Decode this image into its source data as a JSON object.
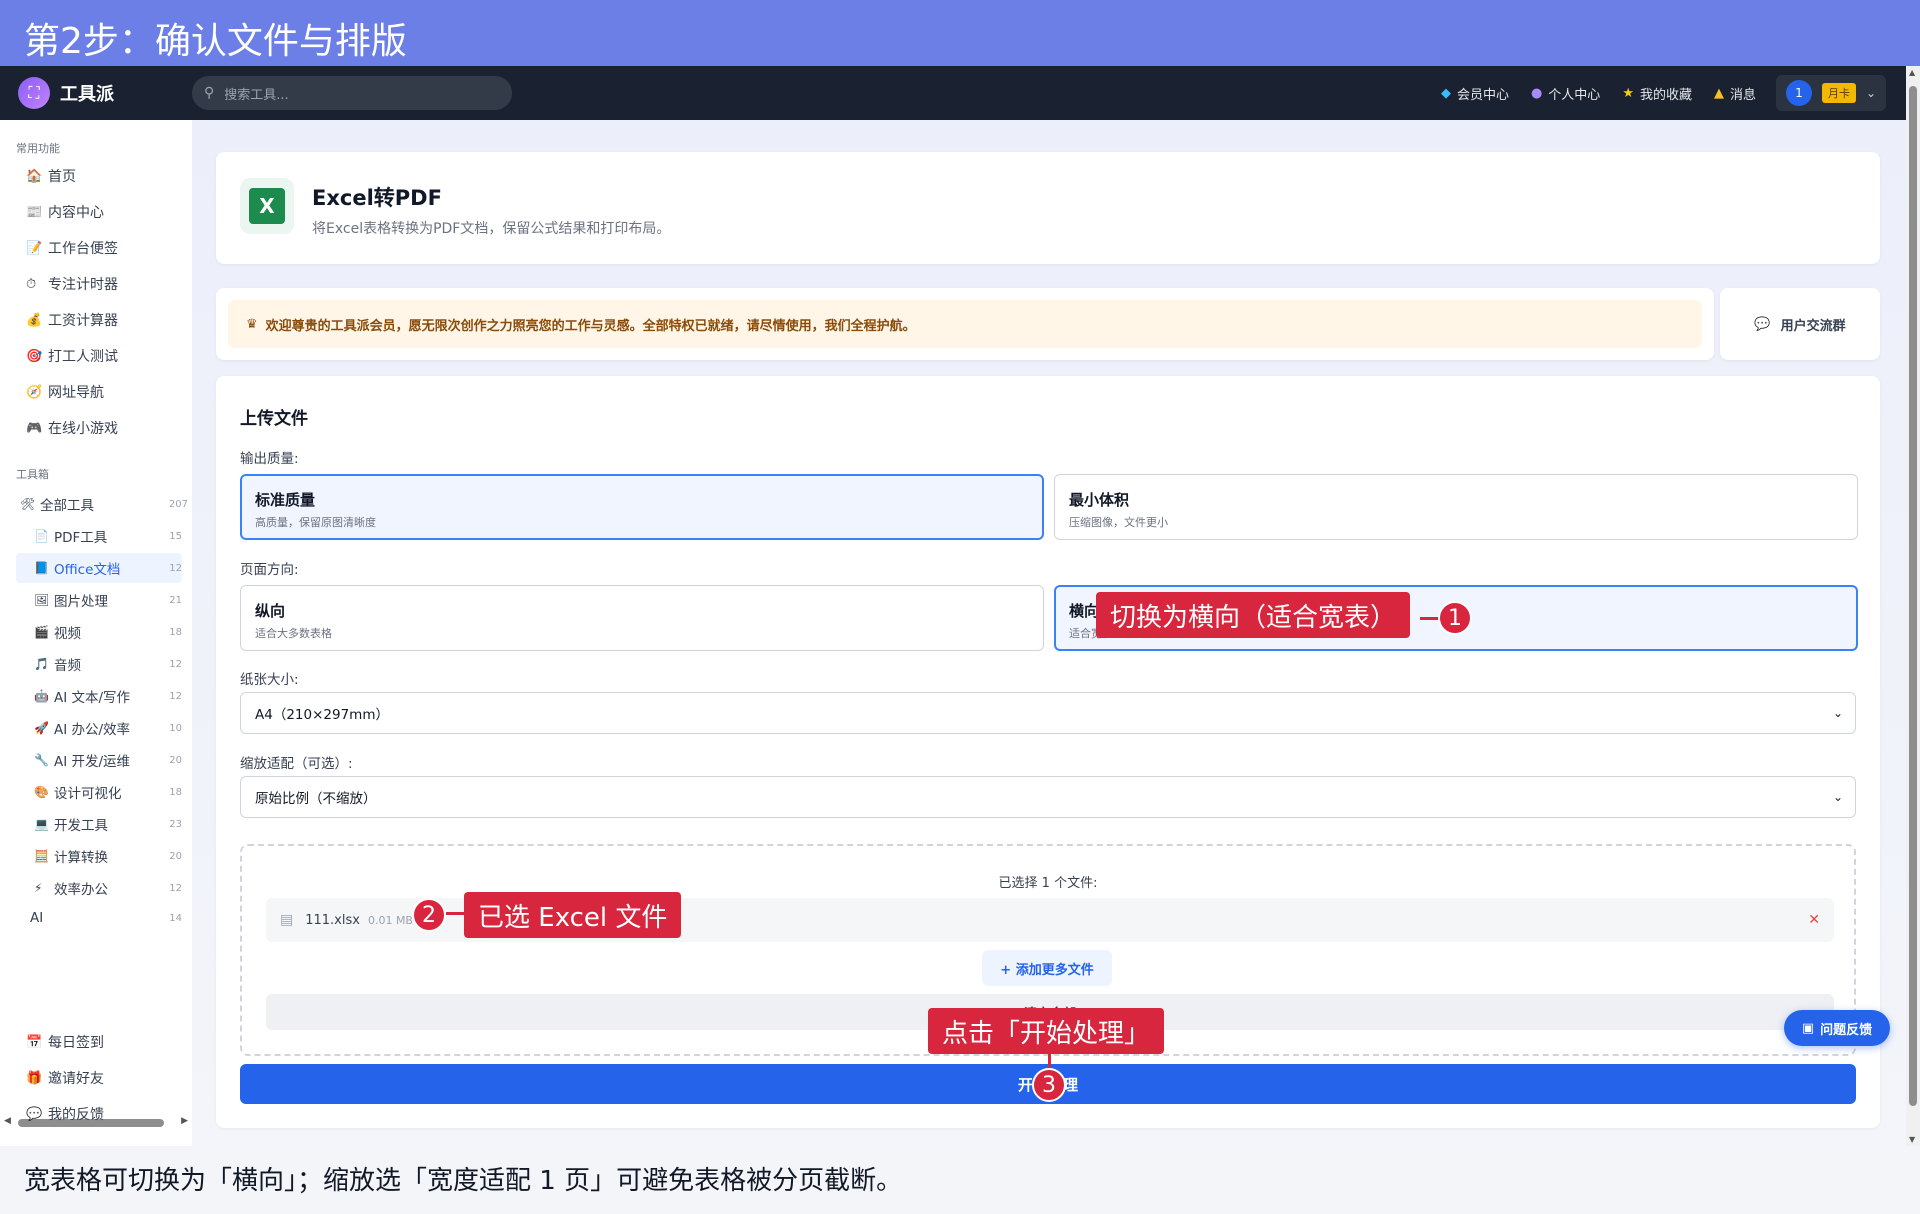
{
  "banner": {
    "title": "第2步：确认文件与排版"
  },
  "topnav": {
    "brand": "工具派",
    "search_placeholder": "搜索工具...",
    "links": [
      {
        "label": "会员中心",
        "icon": "diamond-icon"
      },
      {
        "label": "个人中心",
        "icon": "user-icon"
      },
      {
        "label": "我的收藏",
        "icon": "star-icon"
      },
      {
        "label": "消息",
        "icon": "bell-icon"
      }
    ],
    "user": {
      "avatar": "1",
      "badge": "月卡"
    }
  },
  "sidebar": {
    "common_title": "常用功能",
    "common": [
      {
        "label": "首页",
        "icon": "🏠"
      },
      {
        "label": "内容中心",
        "icon": "📰"
      },
      {
        "label": "工作台便签",
        "icon": "📝"
      },
      {
        "label": "专注计时器",
        "icon": "⏱"
      },
      {
        "label": "工资计算器",
        "icon": "💰"
      },
      {
        "label": "打工人测试",
        "icon": "🎯"
      },
      {
        "label": "网址导航",
        "icon": "🧭"
      },
      {
        "label": "在线小游戏",
        "icon": "🎮"
      }
    ],
    "toolbox_title": "工具箱",
    "all_tools": {
      "label": "全部工具",
      "count": "207"
    },
    "tools": [
      {
        "label": "PDF工具",
        "count": "15",
        "icon": "📄"
      },
      {
        "label": "Office文档",
        "count": "12",
        "icon": "📘"
      },
      {
        "label": "图片处理",
        "count": "21",
        "icon": "🖼"
      },
      {
        "label": "视频",
        "count": "18",
        "icon": "🎬"
      },
      {
        "label": "音频",
        "count": "12",
        "icon": "🎵"
      },
      {
        "label": "AI 文本/写作",
        "count": "12",
        "icon": "🤖"
      },
      {
        "label": "AI 办公/效率",
        "count": "10",
        "icon": "🚀"
      },
      {
        "label": "AI 开发/运维",
        "count": "20",
        "icon": "🔧"
      },
      {
        "label": "设计可视化",
        "count": "18",
        "icon": "🎨"
      },
      {
        "label": "开发工具",
        "count": "23",
        "icon": "💻"
      },
      {
        "label": "计算转换",
        "count": "20",
        "icon": "🧮"
      },
      {
        "label": "效率办公",
        "count": "12",
        "icon": "⚡"
      },
      {
        "label": "AI",
        "count": "14",
        "icon": ""
      }
    ],
    "bottom": [
      {
        "label": "每日签到",
        "icon": "📅"
      },
      {
        "label": "邀请好友",
        "icon": "🎁"
      },
      {
        "label": "我的反馈",
        "icon": "💬"
      }
    ]
  },
  "tool": {
    "icon_letter": "X",
    "title": "Excel转PDF",
    "desc": "将Excel表格转换为PDF文档，保留公式结果和打印布局。"
  },
  "welcome": "欢迎尊贵的工具派会员，愿无限次创作之力照亮您的工作与灵感。全部特权已就绪，请尽情使用，我们全程护航。",
  "group_button": "用户交流群",
  "upload": {
    "section_title": "上传文件",
    "quality_label": "输出质量:",
    "quality_options": [
      {
        "title": "标准质量",
        "desc": "高质量，保留原图清晰度"
      },
      {
        "title": "最小体积",
        "desc": "压缩图像，文件更小"
      }
    ],
    "orientation_label": "页面方向:",
    "orientation_options": [
      {
        "title": "纵向",
        "desc": "适合大多数表格"
      },
      {
        "title": "横向",
        "desc": "适合宽表"
      }
    ],
    "paper_label": "纸张大小:",
    "paper_value": "A4（210×297mm）",
    "scale_label": "缩放适配（可选）:",
    "scale_value": "原始比例（不缩放）",
    "selected_count": "已选择 1 个文件:",
    "file": {
      "name": "111.xlsx",
      "size": "0.01 MB"
    },
    "add_more": "+ 添加更多文件",
    "clear_all": "清空全部",
    "start": "开始处理"
  },
  "feedback_float": "问题反馈",
  "annotations": [
    {
      "num": "1",
      "text": "切换为横向（适合宽表）"
    },
    {
      "num": "2",
      "text": "已选 Excel 文件"
    },
    {
      "num": "3",
      "text": "点击「开始处理」"
    }
  ],
  "caption": "宽表格可切换为「横向」；缩放选「宽度适配 1 页」可避免表格被分页截断。"
}
